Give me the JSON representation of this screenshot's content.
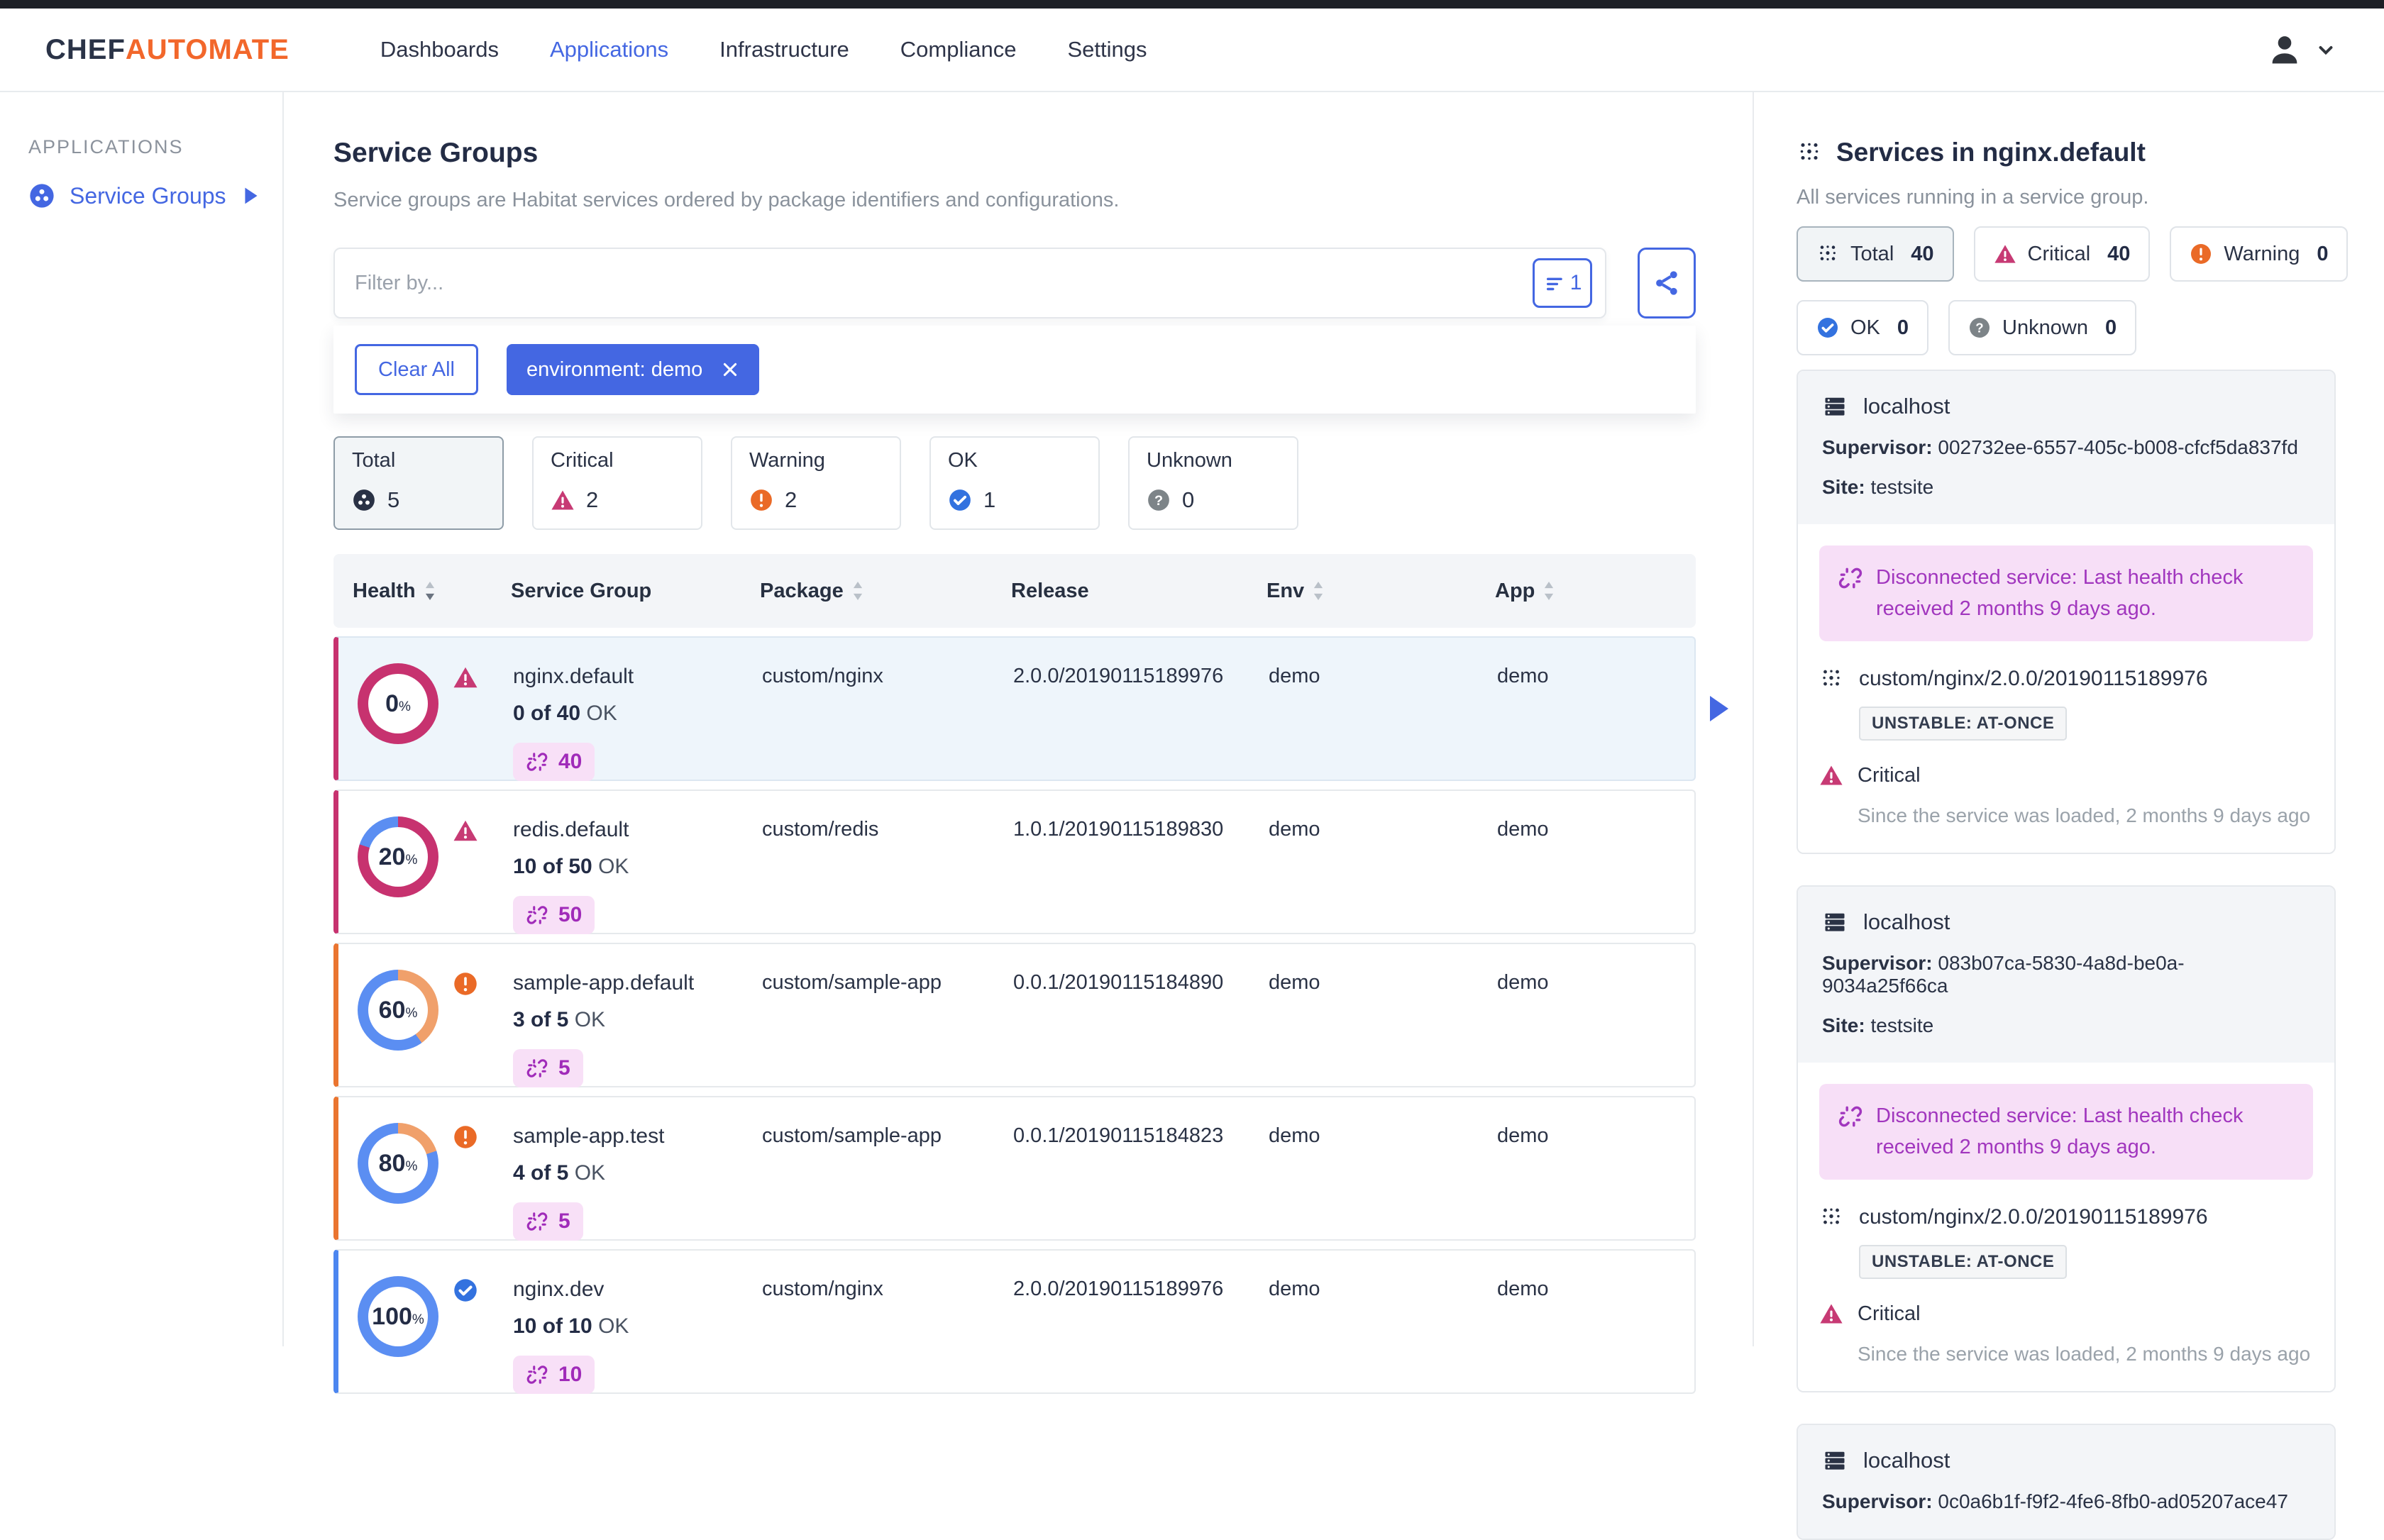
{
  "nav": {
    "brand": {
      "part1": "CHEF",
      "part2": "AUTOMATE"
    },
    "items": [
      {
        "label": "Dashboards",
        "active": false
      },
      {
        "label": "Applications",
        "active": true
      },
      {
        "label": "Infrastructure",
        "active": false
      },
      {
        "label": "Compliance",
        "active": false
      },
      {
        "label": "Settings",
        "active": false
      }
    ]
  },
  "sidebar": {
    "section_label": "APPLICATIONS",
    "items": [
      {
        "label": "Service Groups"
      }
    ]
  },
  "main": {
    "title": "Service Groups",
    "subtitle": "Service groups are Habitat services ordered by package identifiers and configurations.",
    "filter_bar": {
      "placeholder": "Filter by...",
      "filter_count": "1",
      "clear_all_label": "Clear All",
      "chips": [
        {
          "label": "environment: demo"
        }
      ]
    },
    "status_tabs": [
      {
        "label": "Total",
        "count": "5",
        "selected": true
      },
      {
        "label": "Critical",
        "count": "2",
        "selected": false
      },
      {
        "label": "Warning",
        "count": "2",
        "selected": false
      },
      {
        "label": "OK",
        "count": "1",
        "selected": false
      },
      {
        "label": "Unknown",
        "count": "0",
        "selected": false
      }
    ],
    "table": {
      "percent_symbol": "%",
      "columns": [
        {
          "label": "Health",
          "sortable": true
        },
        {
          "label": "Service Group",
          "sortable": false
        },
        {
          "label": "Package",
          "sortable": true
        },
        {
          "label": "Release",
          "sortable": false
        },
        {
          "label": "Env",
          "sortable": true
        },
        {
          "label": "App",
          "sortable": true
        }
      ],
      "rows": [
        {
          "name": "nginx.default",
          "ok_count": "0 of 40",
          "ok_suffix": "OK",
          "percent": "0",
          "disconnected_count": "40",
          "package": "custom/nginx",
          "release": "2.0.0/20190115189976",
          "env": "demo",
          "app": "demo",
          "status": "critical",
          "selected": true
        },
        {
          "name": "redis.default",
          "ok_count": "10 of 50",
          "ok_suffix": "OK",
          "percent": "20",
          "disconnected_count": "50",
          "package": "custom/redis",
          "release": "1.0.1/20190115189830",
          "env": "demo",
          "app": "demo",
          "status": "critical",
          "selected": false
        },
        {
          "name": "sample-app.default",
          "ok_count": "3 of 5",
          "ok_suffix": "OK",
          "percent": "60",
          "disconnected_count": "5",
          "package": "custom/sample-app",
          "release": "0.0.1/20190115184890",
          "env": "demo",
          "app": "demo",
          "status": "warning",
          "selected": false
        },
        {
          "name": "sample-app.test",
          "ok_count": "4 of 5",
          "ok_suffix": "OK",
          "percent": "80",
          "disconnected_count": "5",
          "package": "custom/sample-app",
          "release": "0.0.1/20190115184823",
          "env": "demo",
          "app": "demo",
          "status": "warning",
          "selected": false
        },
        {
          "name": "nginx.dev",
          "ok_count": "10 of 10",
          "ok_suffix": "OK",
          "percent": "100",
          "disconnected_count": "10",
          "package": "custom/nginx",
          "release": "2.0.0/20190115189976",
          "env": "demo",
          "app": "demo",
          "status": "ok",
          "selected": false
        }
      ]
    }
  },
  "panel": {
    "title": "Services in nginx.default",
    "subtitle": "All services running in a service group.",
    "pills": [
      {
        "label": "Total",
        "count": "40",
        "selected": true
      },
      {
        "label": "Critical",
        "count": "40",
        "selected": false
      },
      {
        "label": "Warning",
        "count": "0",
        "selected": false
      },
      {
        "label": "OK",
        "count": "0",
        "selected": false
      },
      {
        "label": "Unknown",
        "count": "0",
        "selected": false
      }
    ],
    "cards": [
      {
        "host": "localhost",
        "supervisor_label": "Supervisor:",
        "supervisor_id": "002732ee-6557-405c-b008-cfcf5da837fd",
        "site_label": "Site:",
        "site": "testsite",
        "alert_text": "Disconnected service: Last health check received 2 months 9 days ago.",
        "package": "custom/nginx/2.0.0/20190115189976",
        "badge": "UNSTABLE: AT-ONCE",
        "health": "Critical",
        "since_text": "Since the service was loaded, 2 months 9 days ago"
      },
      {
        "host": "localhost",
        "supervisor_label": "Supervisor:",
        "supervisor_id": "083b07ca-5830-4a8d-be0a-9034a25f66ca",
        "site_label": "Site:",
        "site": "testsite",
        "alert_text": "Disconnected service: Last health check received 2 months 9 days ago.",
        "package": "custom/nginx/2.0.0/20190115189976",
        "badge": "UNSTABLE: AT-ONCE",
        "health": "Critical",
        "since_text": "Since the service was loaded, 2 months 9 days ago"
      },
      {
        "host": "localhost",
        "supervisor_label": "Supervisor:",
        "supervisor_id": "0c0a6b1f-f9f2-4fe6-8fb0-ad05207ace47"
      }
    ]
  },
  "colors": {
    "primary_blue": "#4467E2",
    "brand_orange": "#F2672B",
    "critical": "#C73A74",
    "warning": "#EA6A27",
    "ok": "#3372DF",
    "unknown": "#7D8488",
    "disconnected_purple": "#A136BE",
    "disconnected_bg": "#F8E0F7",
    "arc": {
      "critical": "#C7326F",
      "warning": "#F0A06B",
      "ok": "#5B8EF2"
    },
    "border": {
      "critical": "#C7326F",
      "warning": "#EA7530",
      "ok": "#4C86F0"
    }
  }
}
